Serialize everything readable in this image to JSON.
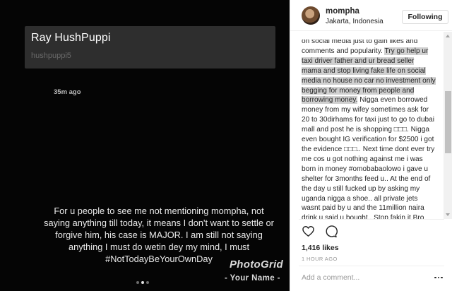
{
  "story": {
    "name": "Ray HushPuppi",
    "handle": "hushpuppi5",
    "time": "35m ago",
    "text": "For u people to see me not mentioning mompha, not saying anything till today, it means I don't want to settle or forgive him, his case is MAJOR. I am still not saying anything I must do wetin dey my mind, I must #NotTodayBeYourOwnDay",
    "watermark_brand": "PhotoGrid",
    "watermark_name": "- Your Name -",
    "carousel": {
      "count": 3,
      "active_index": 1
    }
  },
  "post": {
    "username": "mompha",
    "location": "Jakarta, Indonesia",
    "follow_label": "Following",
    "caption": {
      "before_highlight": "on social media just to gain likes and comments and popularity. ",
      "highlight": "Try go help ur taxi driver father and ur bread seller mama and stop living fake life on social media no house no car no investment only begging for money from people and borrowing money.",
      "after_highlight": " Nigga even borrowed money from my wifey sometimes ask for 20 to 30dirhams for taxi just to go to dubai mall and post he is shopping □□□. Nigga even bought IG verification for $2500 i got the evidence □□□.. Next time dont ever try me cos u got nothing against me i was born in money #omobabaolowo i gave u shelter for 3months feed u.. At the end of the day u still fucked up by asking my uganda nigga a shoe.. all private jets wasnt paid by u and the 11million naira drink u said u bought.. Stop fakin it Bro Cos u already lost it by trying to attack me.. Less i forget i was the one who always give u money especially our trip to milan □□□□."
    },
    "likes": "1,416 likes",
    "time_ago": "1 HOUR AGO",
    "comment_placeholder": "Add a comment..."
  },
  "icons": [
    "heart-icon",
    "comment-icon",
    "more-options-icon",
    "scroll-up-arrow-icon",
    "scroll-down-arrow-icon"
  ],
  "colors": {
    "image_bg": "#050505",
    "story_header_bg": "#2e2e2e",
    "text_primary": "#262626",
    "text_muted": "#999999",
    "highlight": "#d0d0d0"
  }
}
